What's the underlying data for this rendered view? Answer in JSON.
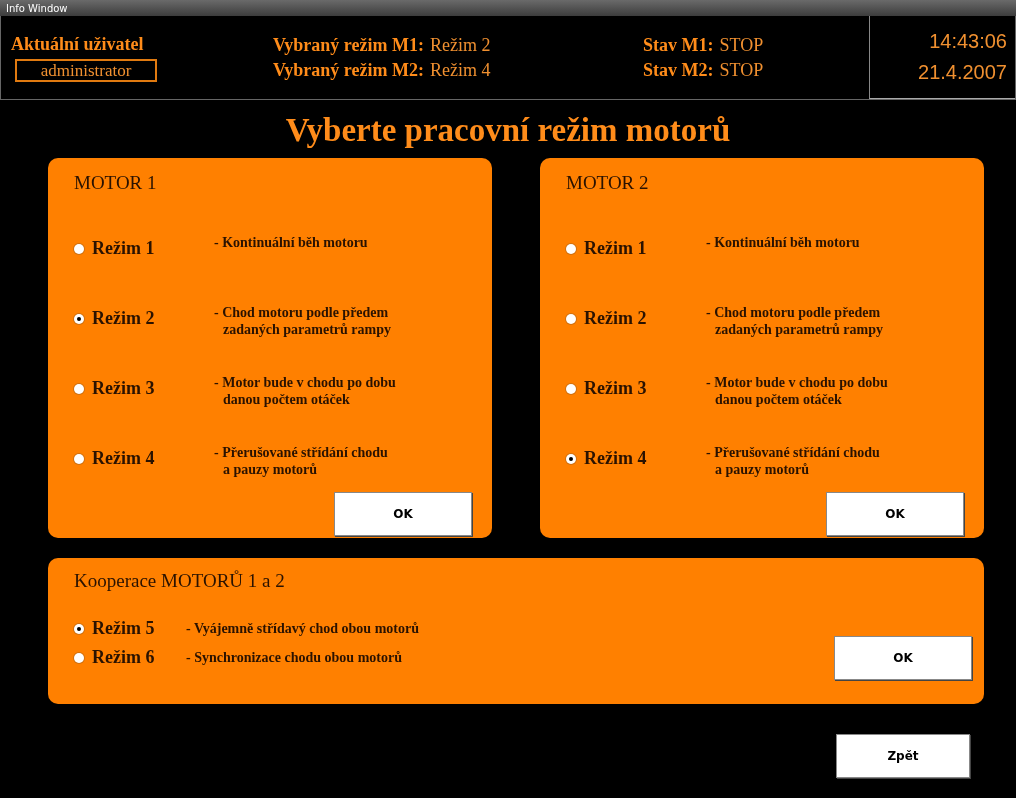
{
  "window": {
    "title": "Info Window"
  },
  "header": {
    "user_label": "Aktuální uživatel",
    "user": "administrator",
    "modes": [
      {
        "label": "Vybraný režim M1:",
        "value": "Režim 2"
      },
      {
        "label": "Vybraný režim M2:",
        "value": "Režim 4"
      }
    ],
    "states": [
      {
        "label": "Stav M1:",
        "value": "STOP"
      },
      {
        "label": "Stav M2:",
        "value": "STOP"
      }
    ],
    "time": "14:43:06",
    "date": "21.4.2007"
  },
  "heading": "Vyberte pracovní režim motorů",
  "motors": [
    {
      "title": "MOTOR 1",
      "button": "OK",
      "options": [
        {
          "label": "Režim 1",
          "description": "- Kontinuální běh motoru",
          "selected": false
        },
        {
          "label": "Režim 2",
          "description": "- Chod motoru podle předem\nzadaných parametrů rampy",
          "selected": true
        },
        {
          "label": "Režim 3",
          "description": "- Motor bude v chodu po dobu\ndanou počtem otáček",
          "selected": false
        },
        {
          "label": "Režim 4",
          "description": "- Přerušované střídání chodu\na pauzy motorů",
          "selected": false
        }
      ]
    },
    {
      "title": "MOTOR 2",
      "button": "OK",
      "options": [
        {
          "label": "Režim 1",
          "description": "- Kontinuální běh motoru",
          "selected": false
        },
        {
          "label": "Režim 2",
          "description": "- Chod motoru podle předem\nzadaných parametrů rampy",
          "selected": false
        },
        {
          "label": "Režim 3",
          "description": "- Motor bude v chodu po dobu\ndanou počtem otáček",
          "selected": false
        },
        {
          "label": "Režim 4",
          "description": "- Přerušované střídání chodu\na pauzy motorů",
          "selected": true
        }
      ]
    }
  ],
  "cooperation": {
    "title": "Kooperace MOTORŮ 1 a 2",
    "button": "OK",
    "options": [
      {
        "label": "Režim 5",
        "description": "- Vyájemně střídavý chod obou motorů",
        "selected": true
      },
      {
        "label": "Režim 6",
        "description": "- Synchronizace chodu obou motorů",
        "selected": false
      }
    ]
  },
  "back_button": "Zpět"
}
